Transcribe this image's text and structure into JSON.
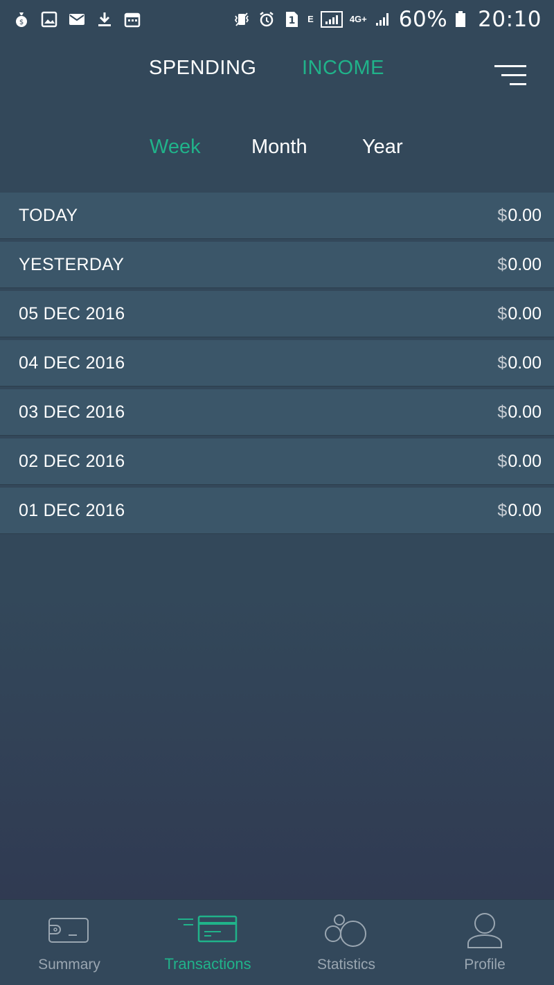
{
  "status_bar": {
    "battery_percent": "60%",
    "time": "20:10",
    "network_e": "E",
    "network_4g": "4G+",
    "sim_slot": "1",
    "left_icons": [
      "money-bag-icon",
      "image-icon",
      "mail-icon",
      "download-icon",
      "calendar-icon"
    ],
    "right_icons": [
      "vibrate-icon",
      "alarm-icon",
      "sim-icon",
      "signal-icon",
      "signal-icon",
      "battery-icon"
    ]
  },
  "header": {
    "tabs": [
      {
        "label": "SPENDING",
        "active": false
      },
      {
        "label": "INCOME",
        "active": true
      }
    ],
    "menu_icon": "hamburger-menu-icon"
  },
  "period_tabs": [
    {
      "label": "Week",
      "active": true
    },
    {
      "label": "Month",
      "active": false
    },
    {
      "label": "Year",
      "active": false
    }
  ],
  "transactions": [
    {
      "date": "TODAY",
      "currency": "$",
      "amount": "0.00"
    },
    {
      "date": "YESTERDAY",
      "currency": "$",
      "amount": "0.00"
    },
    {
      "date": "05 DEC 2016",
      "currency": "$",
      "amount": "0.00"
    },
    {
      "date": "04 DEC 2016",
      "currency": "$",
      "amount": "0.00"
    },
    {
      "date": "03 DEC 2016",
      "currency": "$",
      "amount": "0.00"
    },
    {
      "date": "02 DEC 2016",
      "currency": "$",
      "amount": "0.00"
    },
    {
      "date": "01 DEC 2016",
      "currency": "$",
      "amount": "0.00"
    }
  ],
  "bottom_nav": [
    {
      "label": "Summary",
      "icon": "wallet-icon",
      "active": false
    },
    {
      "label": "Transactions",
      "icon": "card-icon",
      "active": true
    },
    {
      "label": "Statistics",
      "icon": "bubbles-icon",
      "active": false
    },
    {
      "label": "Profile",
      "icon": "user-icon",
      "active": false
    }
  ],
  "colors": {
    "accent": "#20b38a",
    "background": "#33485a",
    "row": "#3b5669",
    "inactive_nav": "#9aa6b1"
  }
}
